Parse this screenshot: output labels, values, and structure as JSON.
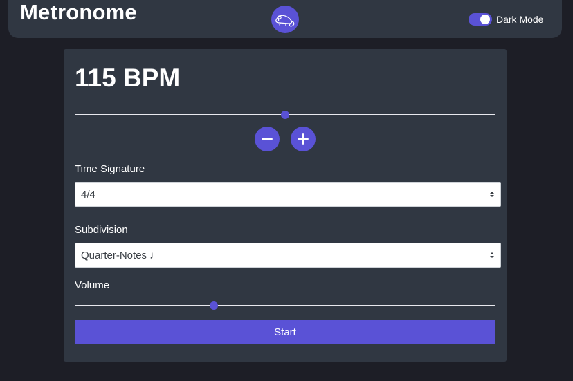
{
  "header": {
    "title": "Metronome",
    "logo_icon": "rat-icon",
    "dark_mode_label": "Dark Mode",
    "dark_mode_on": true
  },
  "tempo": {
    "display": "115 BPM",
    "value": 115,
    "slider_fraction": 0.5,
    "decrease_icon": "minus-icon",
    "increase_icon": "plus-icon"
  },
  "time_signature": {
    "label": "Time Signature",
    "selected": "4/4"
  },
  "subdivision": {
    "label": "Subdivision",
    "selected": "Quarter-Notes ♩"
  },
  "volume": {
    "label": "Volume",
    "fraction": 0.33
  },
  "start_label": "Start",
  "colors": {
    "accent": "#5a52d6",
    "background": "#1d1e26",
    "panel": "#303742"
  }
}
